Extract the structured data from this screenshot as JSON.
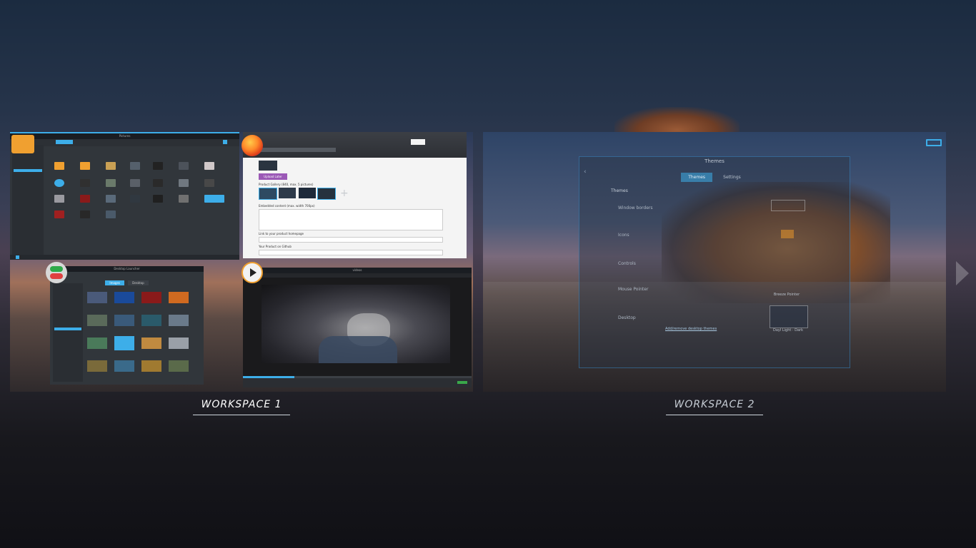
{
  "workspaces": [
    {
      "label": "WORKSPACE 1",
      "active": true
    },
    {
      "label": "WORKSPACE 2",
      "active": false
    }
  ],
  "workspace1": {
    "files_window": {
      "title": "Pictures"
    },
    "browser_window": {
      "button_label": "Upload Later",
      "gallery_label": "Product Gallery (840, max. 5 pictures)",
      "embedded_label": "Embedded content (max. width 700px)",
      "homepage_label": "Link to your product homepage",
      "github_label": "Your Product on Github"
    },
    "wallpaper_window": {
      "title": "Desktop Launcher",
      "tabs": [
        "Images",
        "Desktop"
      ]
    },
    "media_window": {
      "title": "videos"
    }
  },
  "workspace2": {
    "themes_window": {
      "title": "Themes",
      "tabs": [
        "Themes",
        "Settings"
      ],
      "section_title": "Themes",
      "rows": [
        "Window borders",
        "Icons",
        "Controls",
        "Mouse Pointer",
        "Desktop"
      ],
      "cursor_caption": "Breeze Pointer",
      "desktop_caption": "Dayl Light · Dark",
      "link": "Add/remove desktop themes"
    }
  },
  "colors": {
    "accent": "#3daee9",
    "folder": "#f0a030",
    "label_text": "#ffffff"
  },
  "icons": {
    "files_app": "folder-icon",
    "browser_app": "firefox-icon",
    "settings_app": "toggle-switch-icon",
    "media_app": "play-icon",
    "workspace_badge": "window-icon",
    "next": "chevron-right-icon"
  }
}
